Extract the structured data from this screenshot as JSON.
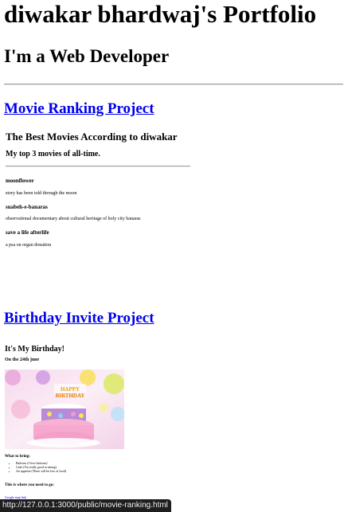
{
  "header": {
    "title": "diwakar bhardwaj's Portfolio",
    "subtitle": "I'm a Web Developer"
  },
  "projects": [
    {
      "link_label": "Movie Ranking Project",
      "embed": {
        "title": "The Best Movies According to diwakar",
        "subtitle": "My top 3 movies of all-time.",
        "movies": [
          {
            "name": "moonflower",
            "description": "story has been told through the moon"
          },
          {
            "name": "suabeh-e-banaras",
            "description": "observational documentary about cultural heritage of holy city banaras"
          },
          {
            "name": "save a life afterlife",
            "description": "a psa on organ donation"
          }
        ]
      }
    },
    {
      "link_label": "Birthday Invite Project",
      "embed": {
        "title": "It's My Birthday!",
        "subtitle": "On the 24th june",
        "image_alt": "birthday cake with 'Happy Birthday' topper",
        "bring_heading": "What to bring:",
        "bring_items": [
          "Baloons (I love baloons)",
          "Cake (I'm really good at eating)",
          "An appetite (There will be lots of food)"
        ],
        "location_heading": "This is where you need to go:",
        "map_link": "Google map link"
      }
    }
  ],
  "status_bar": {
    "url": "http://127.0.0.1:3000/public/movie-ranking.html"
  }
}
